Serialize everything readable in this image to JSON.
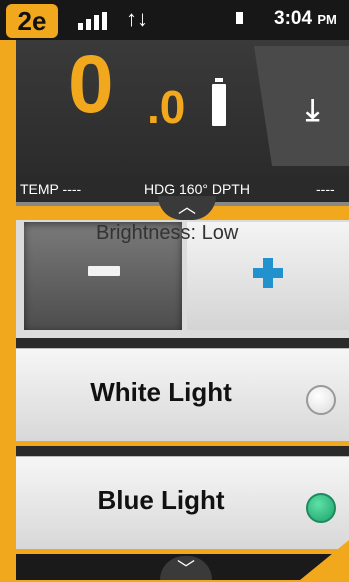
{
  "status_bar": {
    "badge": "2e",
    "transfer_icon": "↑↓",
    "time": "3:04",
    "ampm": "PM"
  },
  "speed": {
    "whole": "0",
    "decimal": ".0"
  },
  "data_strip": {
    "temp": "TEMP ----",
    "hdg": "HDG 160° DPTH",
    "dpth_value": "----"
  },
  "brightness": {
    "label": "Brightness: Low"
  },
  "lights": [
    {
      "label": "White Light",
      "selected": false
    },
    {
      "label": "Blue Light",
      "selected": true
    }
  ],
  "colors": {
    "accent": "#f2a81d",
    "plus": "#2292cf",
    "selected_radio": "#1aa36b"
  }
}
